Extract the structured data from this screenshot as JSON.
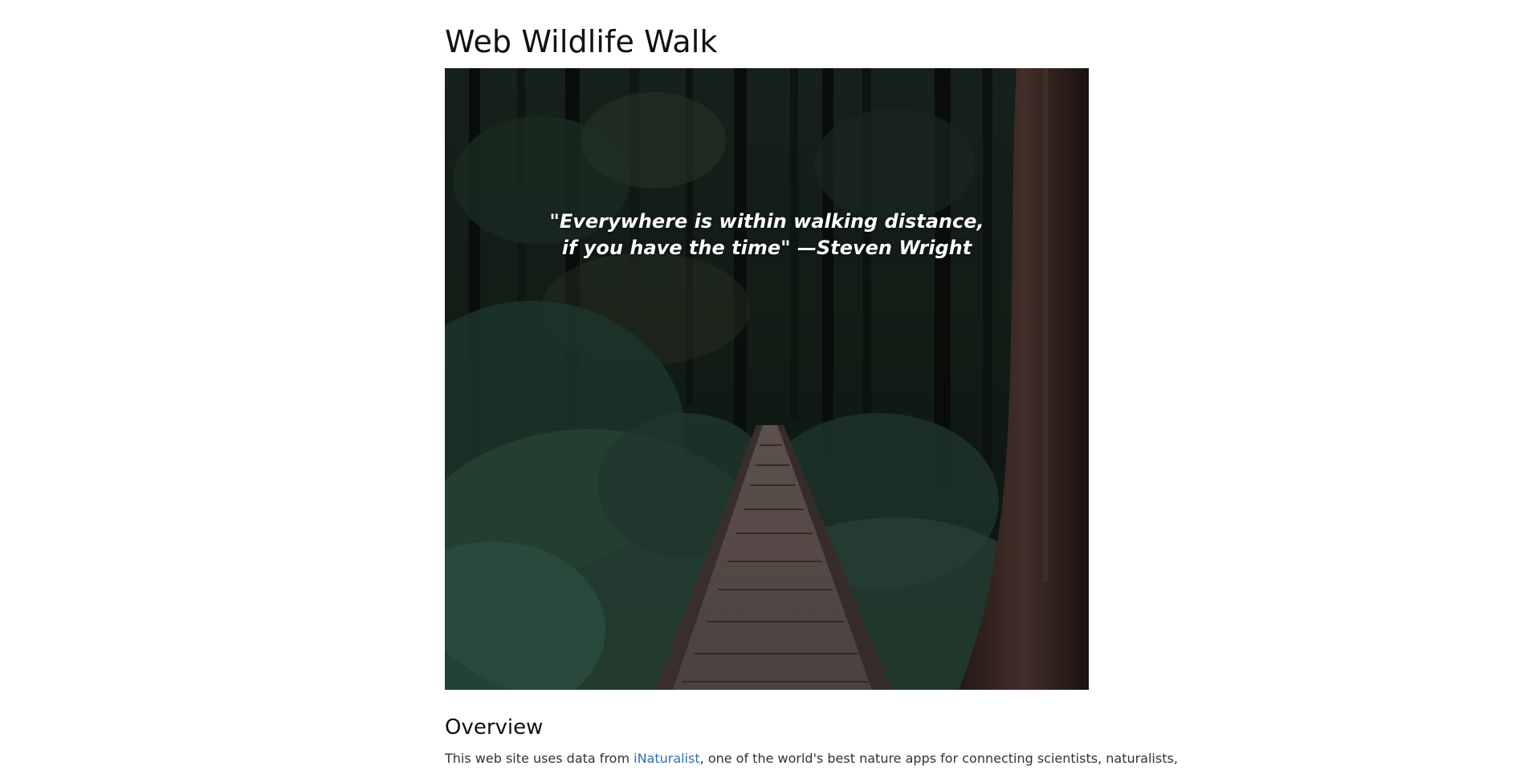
{
  "page": {
    "title": "Web Wildlife Walk"
  },
  "hero": {
    "quote_line1": "\"Everywhere is within walking distance,",
    "quote_line2": "if you have the time\" —Steven Wright",
    "colors": {
      "forest_dark": "#0d1411",
      "foliage": "#2b4a3c",
      "boardwalk": "#5b5150",
      "trunk": "#3b2924",
      "quote_text": "#ffffff"
    }
  },
  "overview": {
    "heading": "Overview",
    "text_before_link": "This web site uses data from ",
    "link_text": "iNaturalist",
    "text_after_link": ", one of the world's best nature apps for connecting scientists, naturalists,",
    "link_color": "#2f6fb0"
  }
}
